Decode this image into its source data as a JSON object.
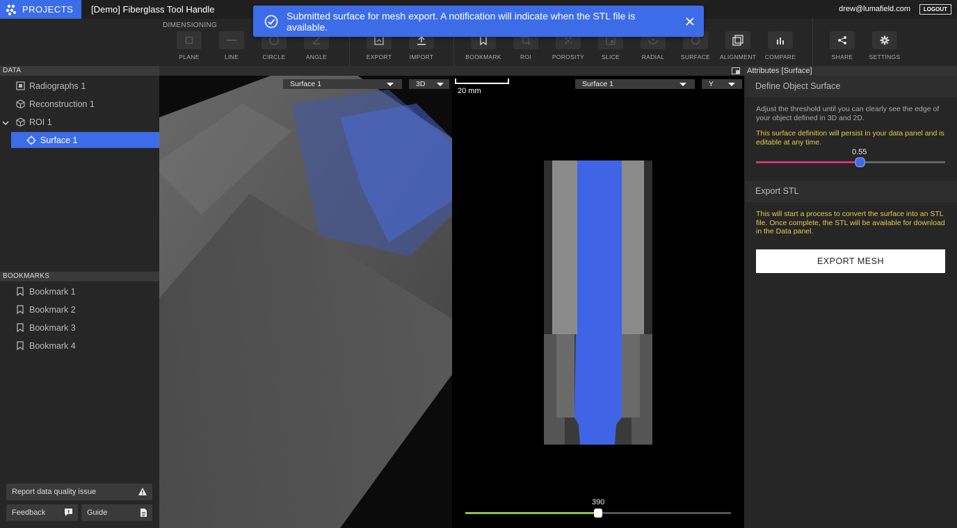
{
  "header": {
    "projects_label": "PROJECTS",
    "project_title": "[Demo] Fiberglass Tool Handle",
    "user_email": "drew@lumafield.com",
    "logout_label": "LOGOUT"
  },
  "toolbar": {
    "section_label": "DIMENSIONING",
    "tools": [
      {
        "label": "PLANE",
        "icon": "square-icon"
      },
      {
        "label": "LINE",
        "icon": "line-icon"
      },
      {
        "label": "CIRCLE",
        "icon": "circle-icon"
      },
      {
        "label": "ANGLE",
        "icon": "angle-icon"
      },
      {
        "label": "EXPORT",
        "icon": "export-icon"
      },
      {
        "label": "IMPORT",
        "icon": "import-icon"
      },
      {
        "label": "BOOKMARK",
        "icon": "bookmark-icon"
      },
      {
        "label": "ROI",
        "icon": "crop-icon"
      },
      {
        "label": "POROSITY",
        "icon": "porosity-icon"
      },
      {
        "label": "SLICE",
        "icon": "slice-icon"
      },
      {
        "label": "RADIAL",
        "icon": "radial-icon"
      },
      {
        "label": "SURFACE",
        "icon": "surface-icon"
      },
      {
        "label": "ALIGNMENT",
        "icon": "alignment-icon"
      },
      {
        "label": "COMPARE",
        "icon": "compare-icon"
      },
      {
        "label": "SHARE",
        "icon": "share-icon"
      },
      {
        "label": "SETTINGS",
        "icon": "gear-icon"
      }
    ]
  },
  "notification": {
    "message": "Submitted surface for mesh export. A notification will indicate when the STL file is available.",
    "icon": "check-circle-icon"
  },
  "data_panel": {
    "title": "DATA",
    "items": [
      {
        "label": "Radiographs 1",
        "icon": "radiograph-icon"
      },
      {
        "label": "Reconstruction 1",
        "icon": "cube-icon"
      },
      {
        "label": "ROI 1",
        "icon": "cube-icon"
      },
      {
        "label": "Surface 1",
        "icon": "surface-icon"
      }
    ]
  },
  "bookmarks_panel": {
    "title": "BOOKMARKS",
    "items": [
      {
        "label": "Bookmark 1"
      },
      {
        "label": "Bookmark 2"
      },
      {
        "label": "Bookmark 3"
      },
      {
        "label": "Bookmark 4"
      }
    ]
  },
  "footer_buttons": {
    "report_label": "Report data quality issue",
    "feedback_label": "Feedback",
    "guide_label": "Guide"
  },
  "viewport": {
    "left_select": "Surface 1",
    "mode_select": "3D",
    "scale_label": "20 mm",
    "right_select": "Surface 1",
    "axis_select": "Y",
    "slice_value": "390",
    "slice_fraction": 0.5
  },
  "attributes_panel": {
    "title": "Attributes [Surface]",
    "define_title": "Define Object Surface",
    "define_text": "Adjust the threshold until you can clearly see the edge of your object defined in 3D and 2D.",
    "define_note": "This surface definition will persist in your data panel and is editable at any time.",
    "threshold_value": "0.55",
    "threshold_fraction": 0.55,
    "export_title": "Export STL",
    "export_text": "This will start a process to convert the surface into an STL file. Once complete, the STL will be available for download in the Data panel.",
    "export_button": "EXPORT MESH"
  },
  "colors": {
    "accent": "#3d6ce8",
    "note_yellow": "#e8c94a",
    "threshold_pink": "#d2337a",
    "slice_green": "#8bc34a"
  }
}
